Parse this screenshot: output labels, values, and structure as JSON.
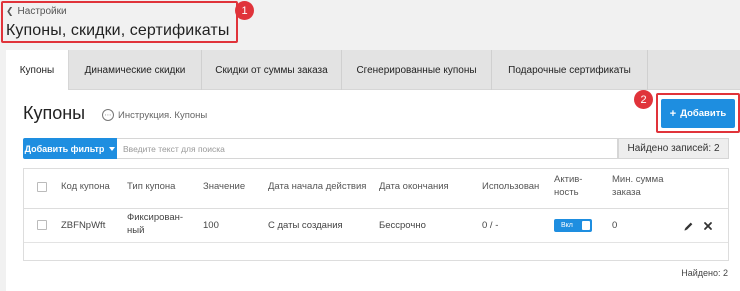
{
  "header": {
    "back_label": "Настройки",
    "title": "Купоны, скидки, сертификаты"
  },
  "annotations": {
    "badge_1": "1",
    "badge_2": "2"
  },
  "tabs": [
    {
      "label": "Купоны",
      "active": true
    },
    {
      "label": "Динамические скидки",
      "active": false
    },
    {
      "label": "Скидки от суммы заказа",
      "active": false
    },
    {
      "label": "Сгенерированные купоны",
      "active": false
    },
    {
      "label": "Подарочные сертификаты",
      "active": false
    }
  ],
  "main": {
    "title": "Купоны",
    "help_label": "Инструкция. Купоны",
    "add_button": "Добавить",
    "filter_button": "Добавить фильтр",
    "search_placeholder": "Введите текст для поиска",
    "found_top": "Найдено записей: 2",
    "found_bottom": "Найдено: 2"
  },
  "table": {
    "columns": {
      "code": "Код купона",
      "type": "Тип купона",
      "value": "Значение",
      "start": "Дата начала действия",
      "end": "Дата окончания",
      "used": "Использован",
      "active": "Актив-ность",
      "min_sum": "Мин. сумма заказа"
    },
    "rows": [
      {
        "code": "ZBFNpWft",
        "type": "Фиксирован-ный",
        "value": "100",
        "start": "С даты создания",
        "end": "Бессрочно",
        "used": "0 / -",
        "active_label": "Вкл",
        "min_sum": "0"
      }
    ]
  },
  "colors": {
    "accent": "#1e8ee0",
    "highlight": "#e0333a"
  },
  "icons": [
    "chevron-left-icon",
    "help-circle-icon",
    "plus-icon",
    "caret-down-icon",
    "pencil-icon",
    "close-icon"
  ]
}
